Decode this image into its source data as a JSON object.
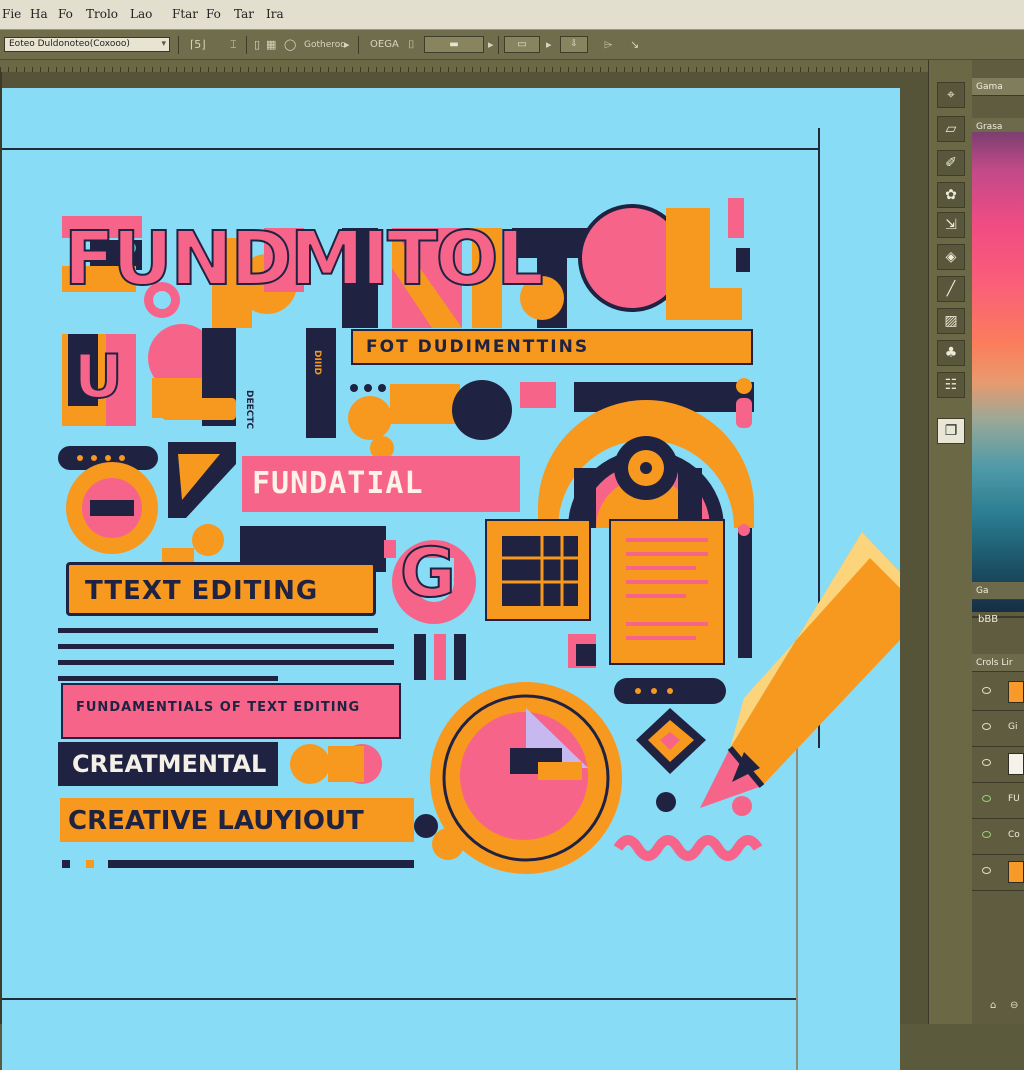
{
  "menubar": {
    "items": [
      "Fie",
      "Ha",
      "Fo",
      "Trolo",
      "Lao",
      "Ftar",
      "Fo",
      "Tar",
      "Ira"
    ]
  },
  "controlbar": {
    "document_field": "Eoteo Duldonoteo(Coxooo)",
    "dropdown_glyph": "▾",
    "style_label": "Gotheroo",
    "align_label": "OEGA",
    "zoom_label": "⇩"
  },
  "toolbar": {
    "tools": [
      {
        "name": "move-tool",
        "glyph": "⌖"
      },
      {
        "name": "eraser-tool",
        "glyph": "▱"
      },
      {
        "name": "pen-tool",
        "glyph": "✐"
      },
      {
        "name": "brush-tool",
        "glyph": "✿"
      },
      {
        "name": "transform-tool",
        "glyph": "⇲"
      },
      {
        "name": "knife-tool",
        "glyph": "◈"
      },
      {
        "name": "line-tool",
        "glyph": "╱"
      },
      {
        "name": "stamp-tool",
        "glyph": "▨"
      },
      {
        "name": "shape-tool",
        "glyph": "♣"
      },
      {
        "name": "text-tool",
        "glyph": "☷"
      },
      {
        "name": "note-tool",
        "glyph": "❐"
      }
    ]
  },
  "panels": {
    "color_tab": "Gama",
    "swatches_tab": "Grasa",
    "mid_tab": "Ga",
    "mid_value": "bBB",
    "layers_tab": "Crols Lir"
  },
  "layers": [
    {
      "color": "#f79a2a",
      "label": ""
    },
    {
      "color": "",
      "label": "Gi"
    },
    {
      "color": "#f4f2ea",
      "label": ""
    },
    {
      "color": "",
      "label": "FU"
    },
    {
      "color": "",
      "label": "Co"
    },
    {
      "color": "#f79a2a",
      "label": ""
    }
  ],
  "artwork": {
    "headline": "FUNDMITOL",
    "banner_subtitle": "FOT DUDIMENTTINS",
    "fundatial": "FUNDATIAL",
    "vertical_a": "DEECTC",
    "vertical_b": "DIIID",
    "text_editing": "TTEXT EDITING",
    "fundamentals": "FUNDAMENTIALS OF TEXT EDITING",
    "creatmental": "CREATMENTAL",
    "creative_layout": "CREATIVE LAUYIOUT",
    "letter_g": "G",
    "letter_g_big": "G",
    "letter_u": "U"
  },
  "colors": {
    "canvas": "#88dcf6",
    "pink": "#f7648a",
    "orange": "#f7981f",
    "navy": "#1f2240"
  }
}
